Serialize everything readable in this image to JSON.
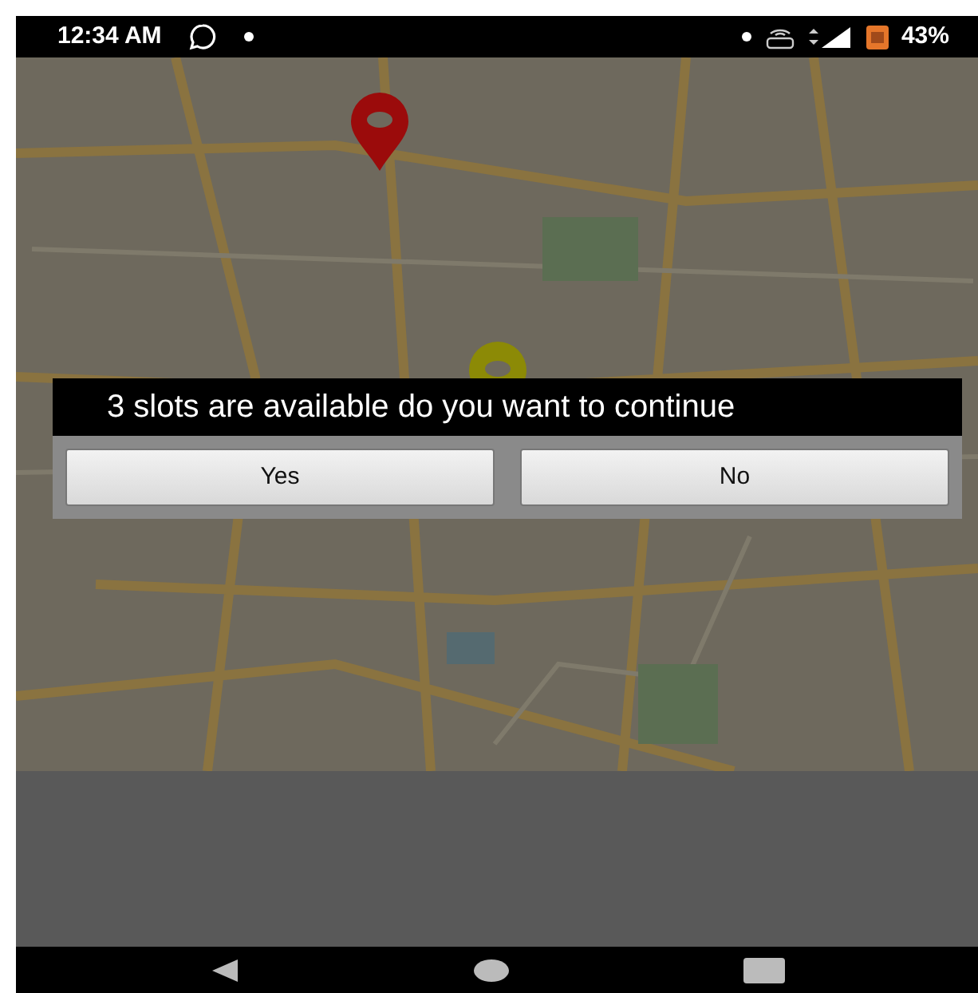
{
  "status_bar": {
    "time": "12:34 AM",
    "battery": "43%"
  },
  "map": {
    "markers": [
      {
        "color": "#9b0b0b"
      },
      {
        "color": "#8c8a06"
      }
    ]
  },
  "dialog": {
    "message": "3 slots are available do you want to continue",
    "buttons": [
      {
        "label": "Yes"
      },
      {
        "label": "No"
      }
    ]
  }
}
